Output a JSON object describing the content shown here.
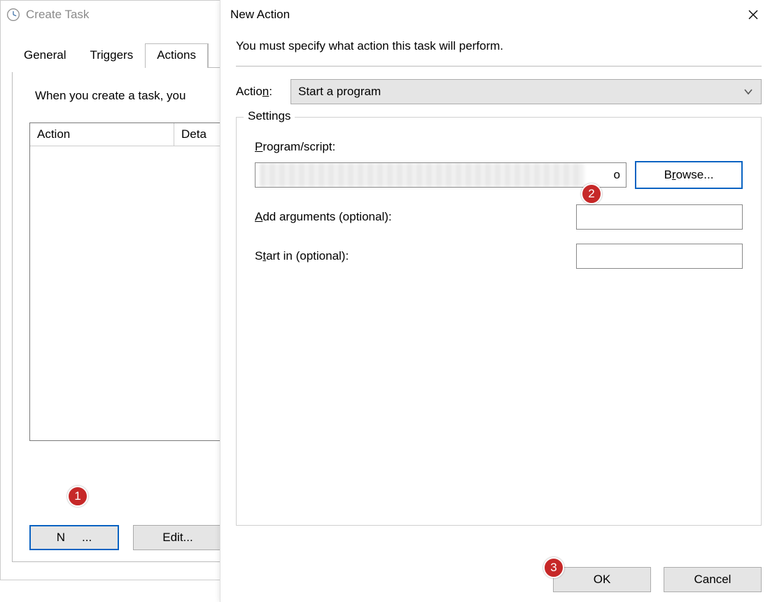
{
  "createTask": {
    "title": "Create Task",
    "tabs": {
      "general": "General",
      "triggers": "Triggers",
      "actions": "Actions"
    },
    "intro": "When you create a task, you",
    "columns": {
      "action": "Action",
      "details": "Deta"
    },
    "buttons": {
      "new": "N",
      "newSuffix": "...",
      "edit": "Edit..."
    }
  },
  "newAction": {
    "title": "New Action",
    "instruction": "You must specify what action this task will perform.",
    "actionLabel": "Action:",
    "actionSelected": "Start a program",
    "settingsLegend": "Settings",
    "programLabel": "Program/script:",
    "programSuffixVisible": "o",
    "browse": "Browse...",
    "addArgsLabel": "Add arguments (optional):",
    "startInLabel": "Start in (optional):",
    "ok": "OK",
    "cancel": "Cancel"
  },
  "annotations": {
    "a1": "1",
    "a2": "2",
    "a3": "3"
  }
}
